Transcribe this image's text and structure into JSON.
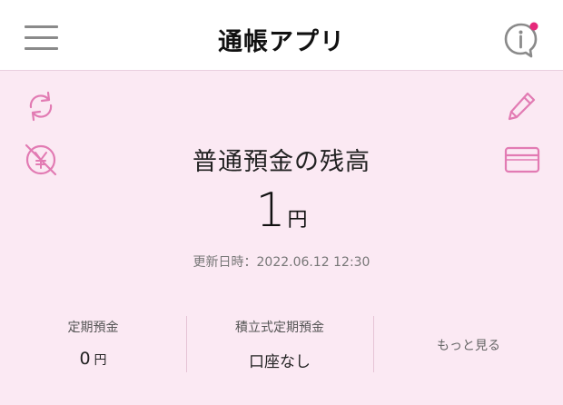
{
  "header": {
    "title": "通帳アプリ",
    "menu_icon": "hamburger-menu-icon",
    "info_icon": "info-bubble-icon",
    "info_badge_color": "#e6287a"
  },
  "icons": {
    "refresh": "refresh-icon",
    "hide_balance": "yen-hidden-icon",
    "edit": "pencil-icon",
    "card": "card-icon",
    "accent_color": "#e27bb3"
  },
  "balance": {
    "title": "普通預金の残高",
    "amount": "1",
    "unit": "円",
    "updated_label": "更新日時：2022.06.12 12:30"
  },
  "summary": {
    "items": [
      {
        "label": "定期預金",
        "value": "0",
        "unit": "円"
      },
      {
        "label": "積立式定期預金",
        "value": "口座なし"
      }
    ],
    "more_label": "もっと見る"
  }
}
